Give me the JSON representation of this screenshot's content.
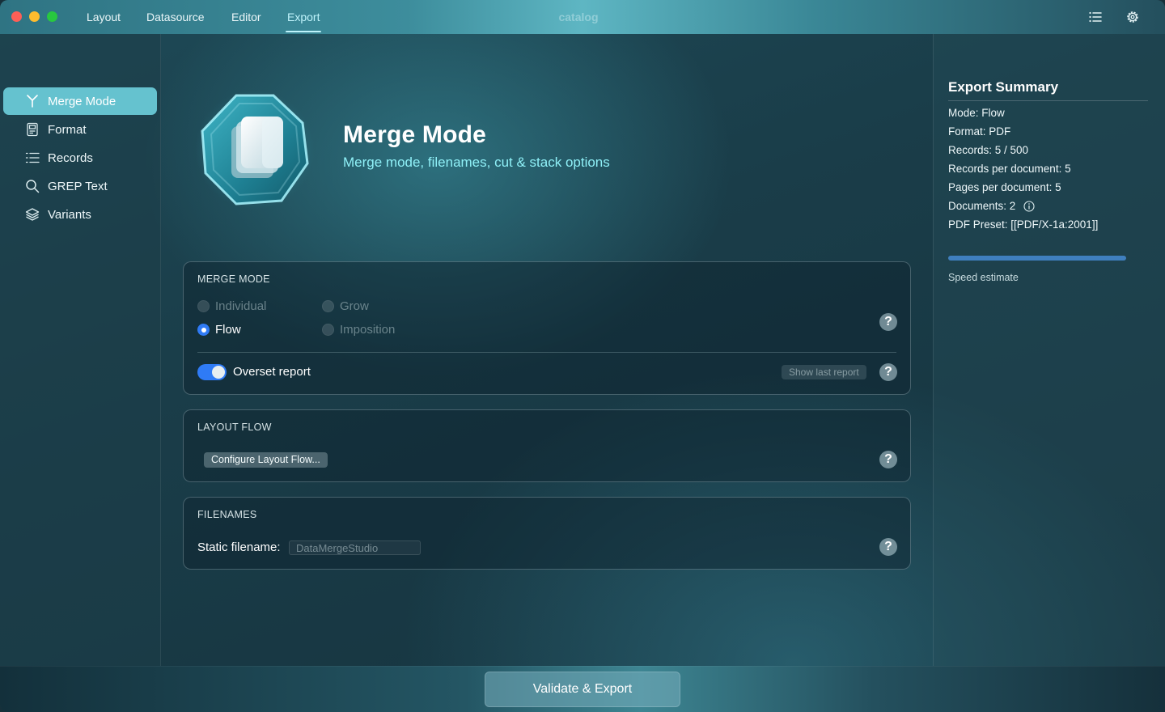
{
  "window": {
    "title": "catalog"
  },
  "nav": {
    "tabs": [
      {
        "label": "Layout"
      },
      {
        "label": "Datasource"
      },
      {
        "label": "Editor"
      },
      {
        "label": "Export",
        "active": true
      }
    ],
    "icons": [
      "list-icon",
      "gear-icon"
    ]
  },
  "sidebar": {
    "items": [
      {
        "label": "Merge Mode",
        "icon": "merge-icon",
        "active": true
      },
      {
        "label": "Format",
        "icon": "format-icon"
      },
      {
        "label": "Records",
        "icon": "records-list-icon"
      },
      {
        "label": "GREP Text",
        "icon": "search-icon"
      },
      {
        "label": "Variants",
        "icon": "layers-icon"
      }
    ]
  },
  "hero": {
    "title": "Merge Mode",
    "subtitle": "Merge mode, filenames, cut & stack options",
    "icon": "documents-stack-icon"
  },
  "merge_mode": {
    "title": "MERGE MODE",
    "options": [
      {
        "label": "Individual",
        "selected": false,
        "enabled": false
      },
      {
        "label": "Grow",
        "selected": false,
        "enabled": false
      },
      {
        "label": "Flow",
        "selected": true,
        "enabled": true
      },
      {
        "label": "Imposition",
        "selected": false,
        "enabled": false
      }
    ],
    "overset_label": "Overset report",
    "overset_on": true,
    "show_last_report": "Show last report"
  },
  "layout_flow": {
    "title": "LAYOUT FLOW",
    "configure_button": "Configure Layout Flow..."
  },
  "filenames": {
    "title": "FILENAMES",
    "static_label": "Static filename:",
    "static_placeholder": "DataMergeStudio"
  },
  "summary": {
    "title": "Export Summary",
    "lines": [
      "Mode: Flow",
      "Format: PDF",
      "Records: 5 / 500",
      "Records per document: 5",
      "Pages per document: 5",
      "Documents: 2",
      "PDF Preset: [[PDF/X-1a:2001]]"
    ],
    "speed_label": "Speed estimate",
    "speed_fraction": 1.0
  },
  "footer": {
    "export_button": "Validate & Export"
  },
  "colors": {
    "accent": "#2f7bf6",
    "sidebar_active": "#65c2cf",
    "subtitle": "#8ff0f7"
  }
}
